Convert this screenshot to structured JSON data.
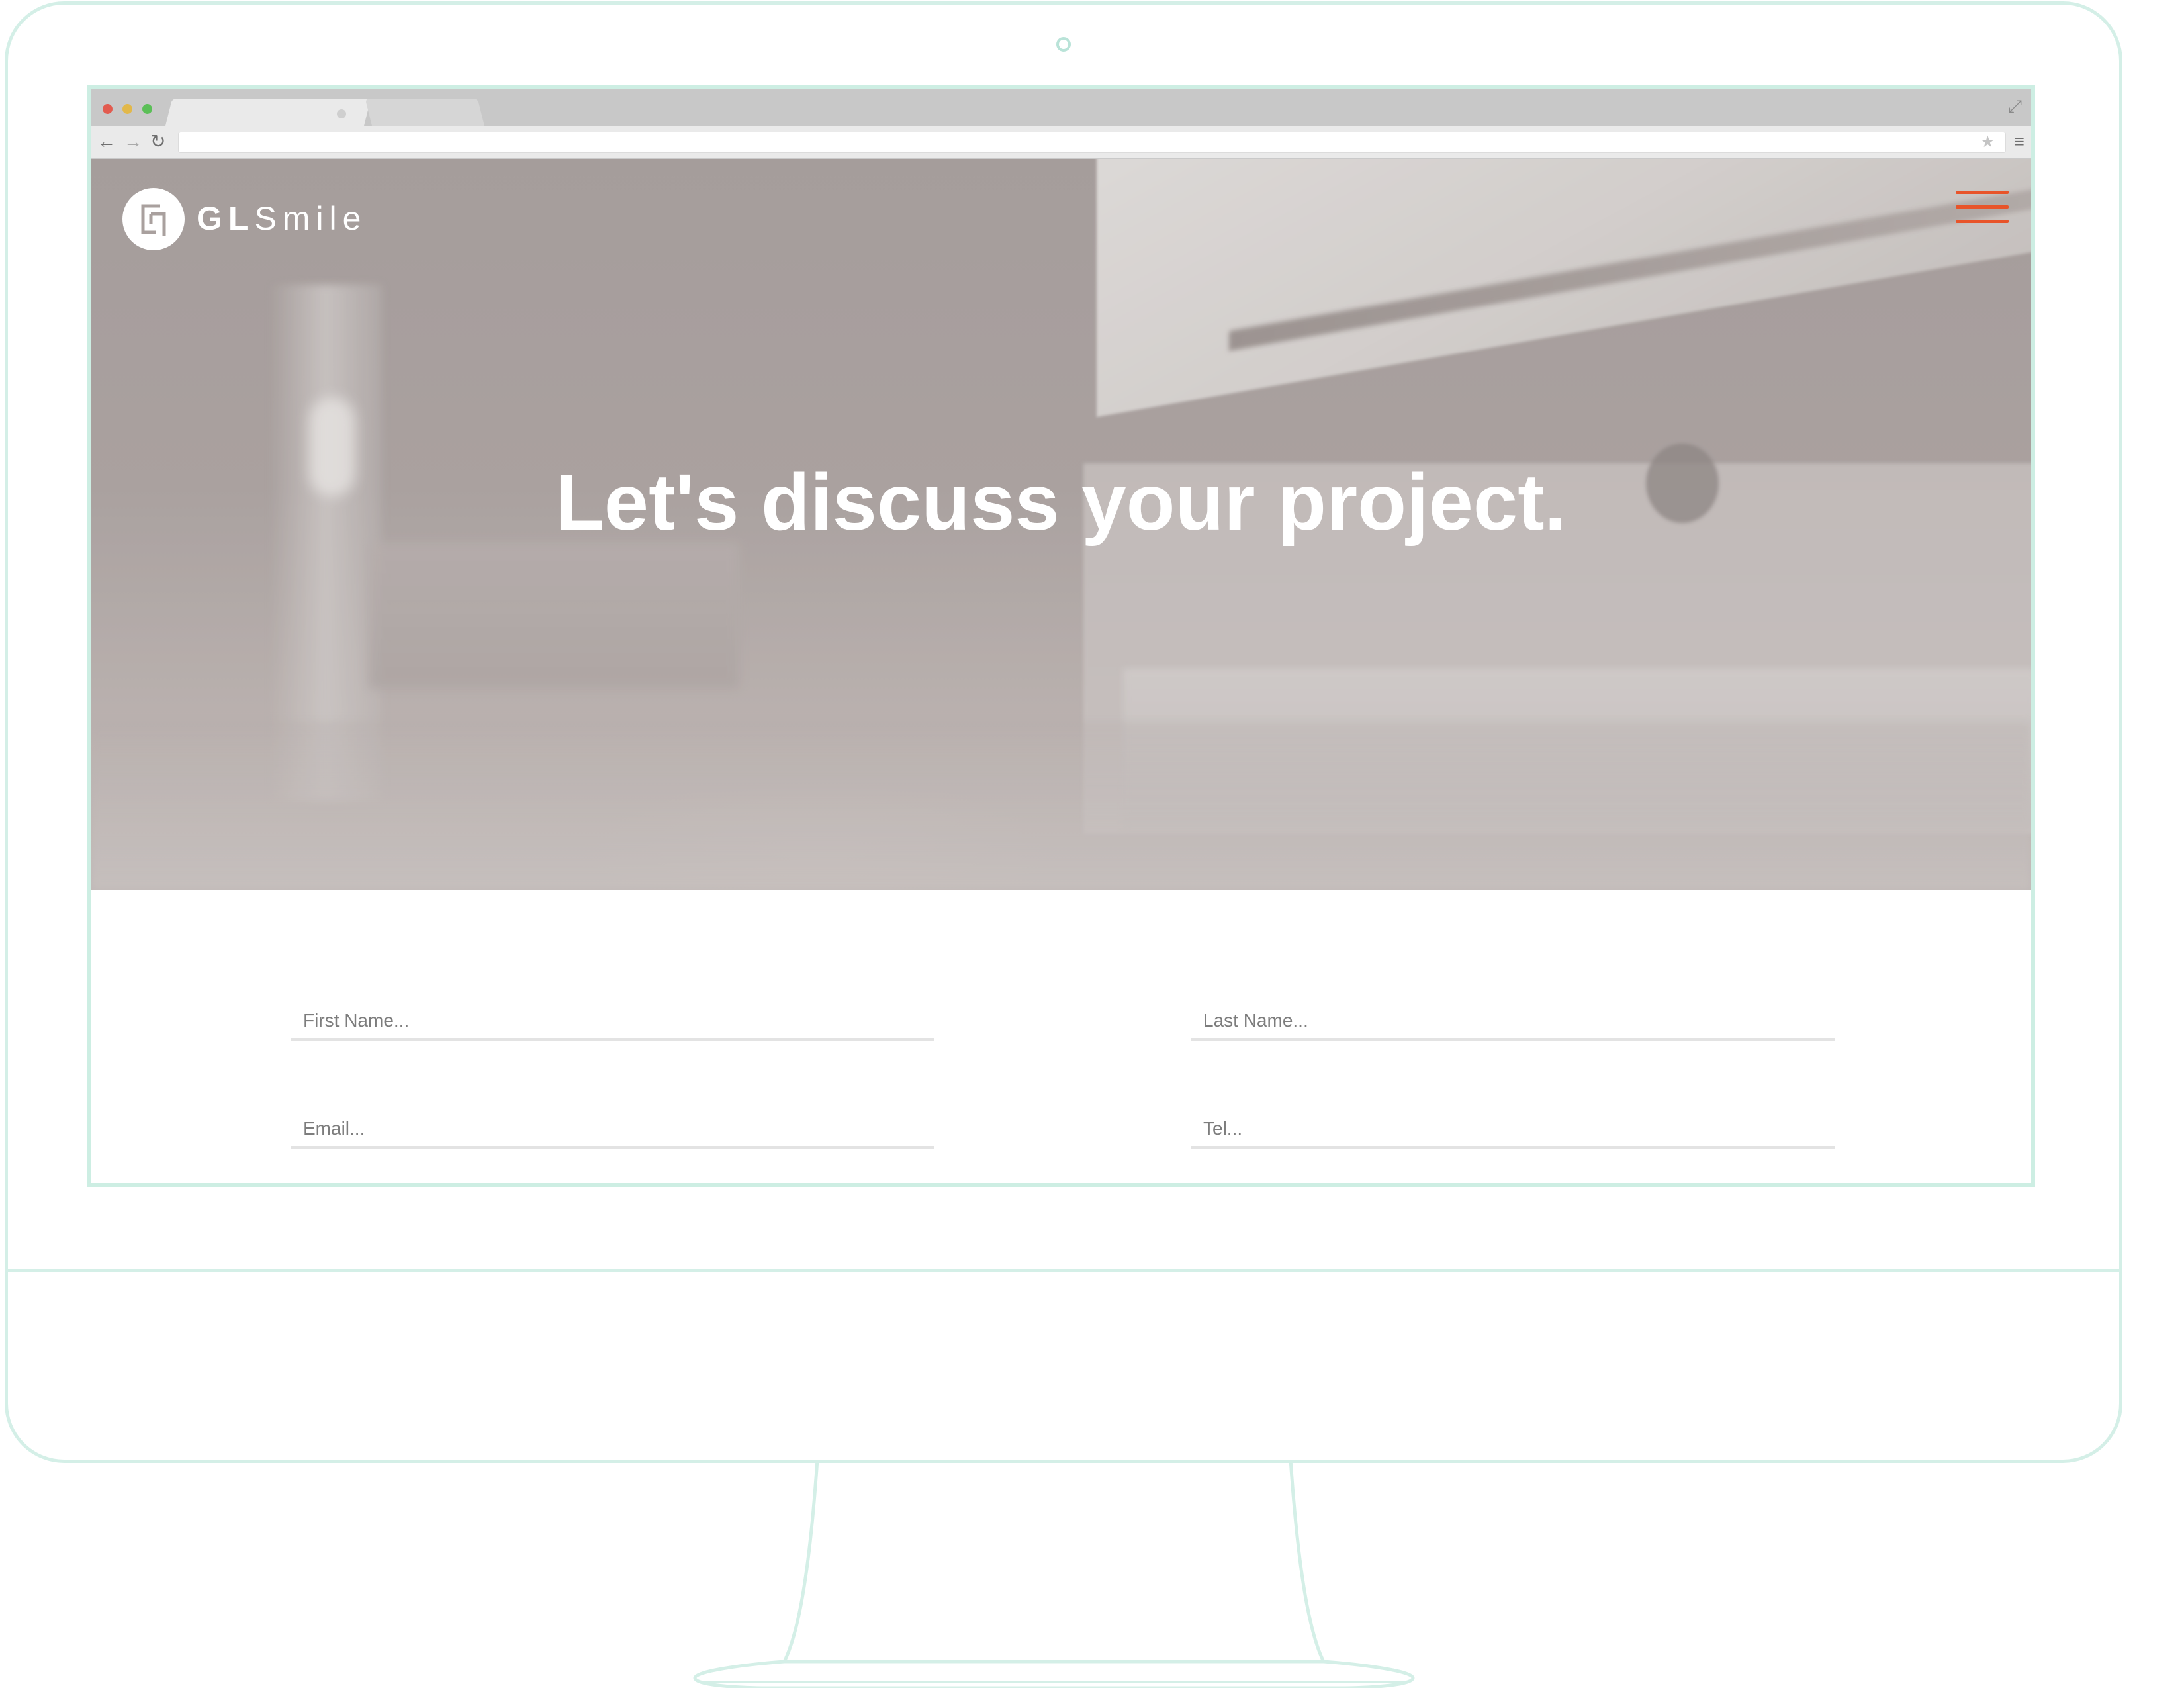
{
  "site": {
    "brand_gl": "GL",
    "brand_smile": "Smile",
    "accent_color": "#e8542a"
  },
  "hero": {
    "headline": "Let's discuss your project."
  },
  "form": {
    "first_name_placeholder": "First Name...",
    "last_name_placeholder": "Last Name...",
    "email_placeholder": "Email...",
    "tel_placeholder": "Tel..."
  },
  "icons": {
    "logo": "gl-monogram-icon",
    "menu": "hamburger-menu-icon",
    "back": "arrow-left-icon",
    "forward": "arrow-right-icon",
    "reload": "reload-icon",
    "bookmark": "star-icon",
    "browser_menu": "menu-icon",
    "fullscreen": "expand-icon"
  },
  "colors": {
    "device_outline": "#d4efe7",
    "hero_tint": "#aea5a3"
  }
}
